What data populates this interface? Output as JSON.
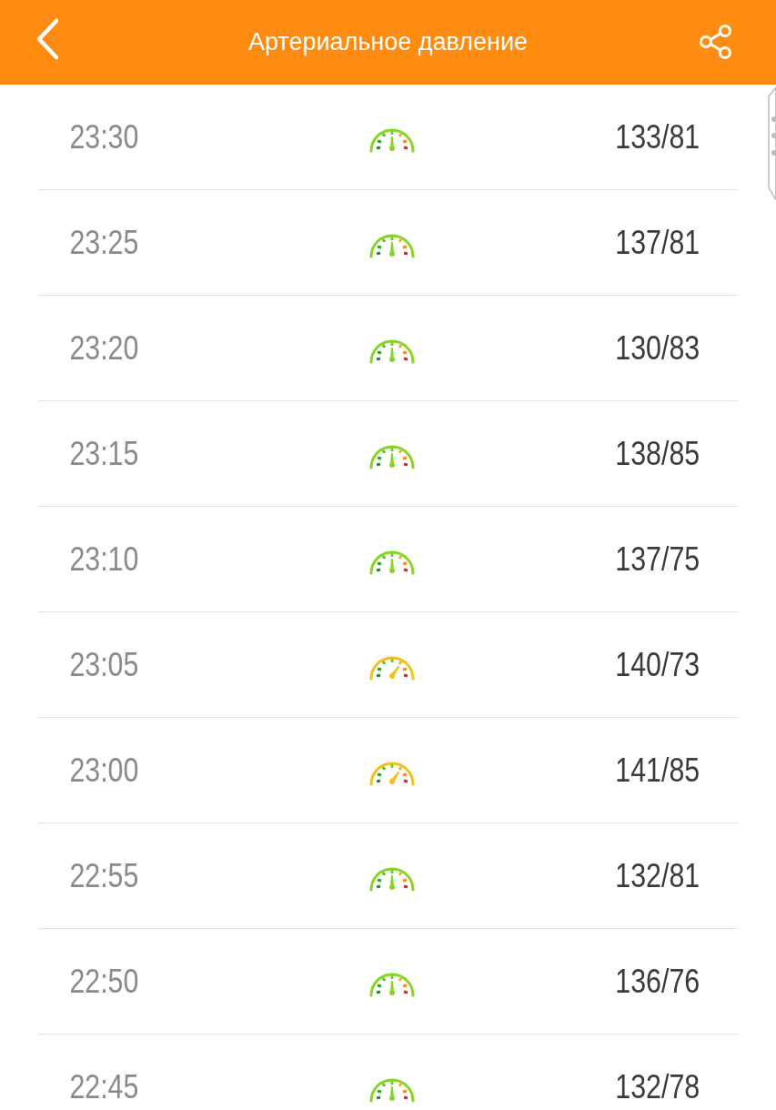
{
  "header": {
    "title": "Артериальное давление"
  },
  "rows": [
    {
      "time": "23:30",
      "kind": "normal",
      "value": "133/81"
    },
    {
      "time": "23:25",
      "kind": "normal",
      "value": "137/81"
    },
    {
      "time": "23:20",
      "kind": "normal",
      "value": "130/83"
    },
    {
      "time": "23:15",
      "kind": "normal",
      "value": "138/85"
    },
    {
      "time": "23:10",
      "kind": "normal",
      "value": "137/75"
    },
    {
      "time": "23:05",
      "kind": "elevated",
      "value": "140/73"
    },
    {
      "time": "23:00",
      "kind": "elevated",
      "value": "141/85"
    },
    {
      "time": "22:55",
      "kind": "normal",
      "value": "132/81"
    },
    {
      "time": "22:50",
      "kind": "normal",
      "value": "136/76"
    },
    {
      "time": "22:45",
      "kind": "normal",
      "value": "132/78"
    }
  ]
}
